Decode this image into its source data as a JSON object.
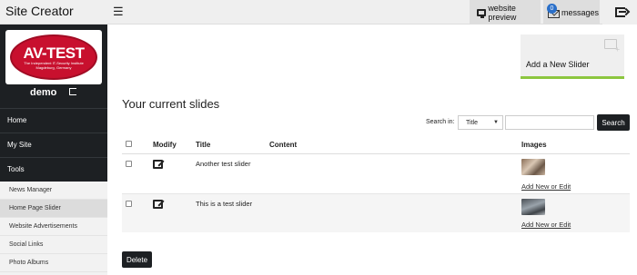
{
  "app": {
    "title": "Site Creator",
    "menu_icon": "hamburger-icon"
  },
  "topbar": {
    "website_preview_label": "website preview",
    "messages_label": "messages",
    "messages_count": "0",
    "preview_icon": "monitor-icon",
    "messages_icon": "envelope-icon",
    "logout_icon": "sign-out-icon"
  },
  "sidebar": {
    "logo_text": "AV-TEST",
    "logo_subtext": "The Independent IT-Security Institute",
    "logo_subtext2": "Magdeburg, Germany",
    "user_name": "demo",
    "nav": [
      {
        "label": "Home"
      },
      {
        "label": "My Site"
      },
      {
        "label": "Tools"
      }
    ],
    "subnav": [
      {
        "label": "News Manager"
      },
      {
        "label": "Home Page Slider"
      },
      {
        "label": "Website Advertisements"
      },
      {
        "label": "Social Links"
      },
      {
        "label": "Photo Albums"
      }
    ]
  },
  "main": {
    "add_slider_label": "Add a New Slider",
    "page_title": "Your current slides",
    "search": {
      "label": "Search in:",
      "select_value": "Title",
      "input_value": "",
      "button_label": "Search"
    },
    "table": {
      "columns": [
        "Modify",
        "Title",
        "Content",
        "Images"
      ],
      "rows": [
        {
          "title": "Another test slider",
          "content": "",
          "images_link": "Add New or Edit"
        },
        {
          "title": "This is a test slider",
          "content": "",
          "images_link": "Add New or Edit"
        }
      ]
    },
    "delete_label": "Delete"
  },
  "colors": {
    "sidebar_bg": "#1d2023",
    "accent_green": "#8cc63f",
    "badge_blue": "#2a6fc9",
    "logo_red": "#c8102e"
  }
}
